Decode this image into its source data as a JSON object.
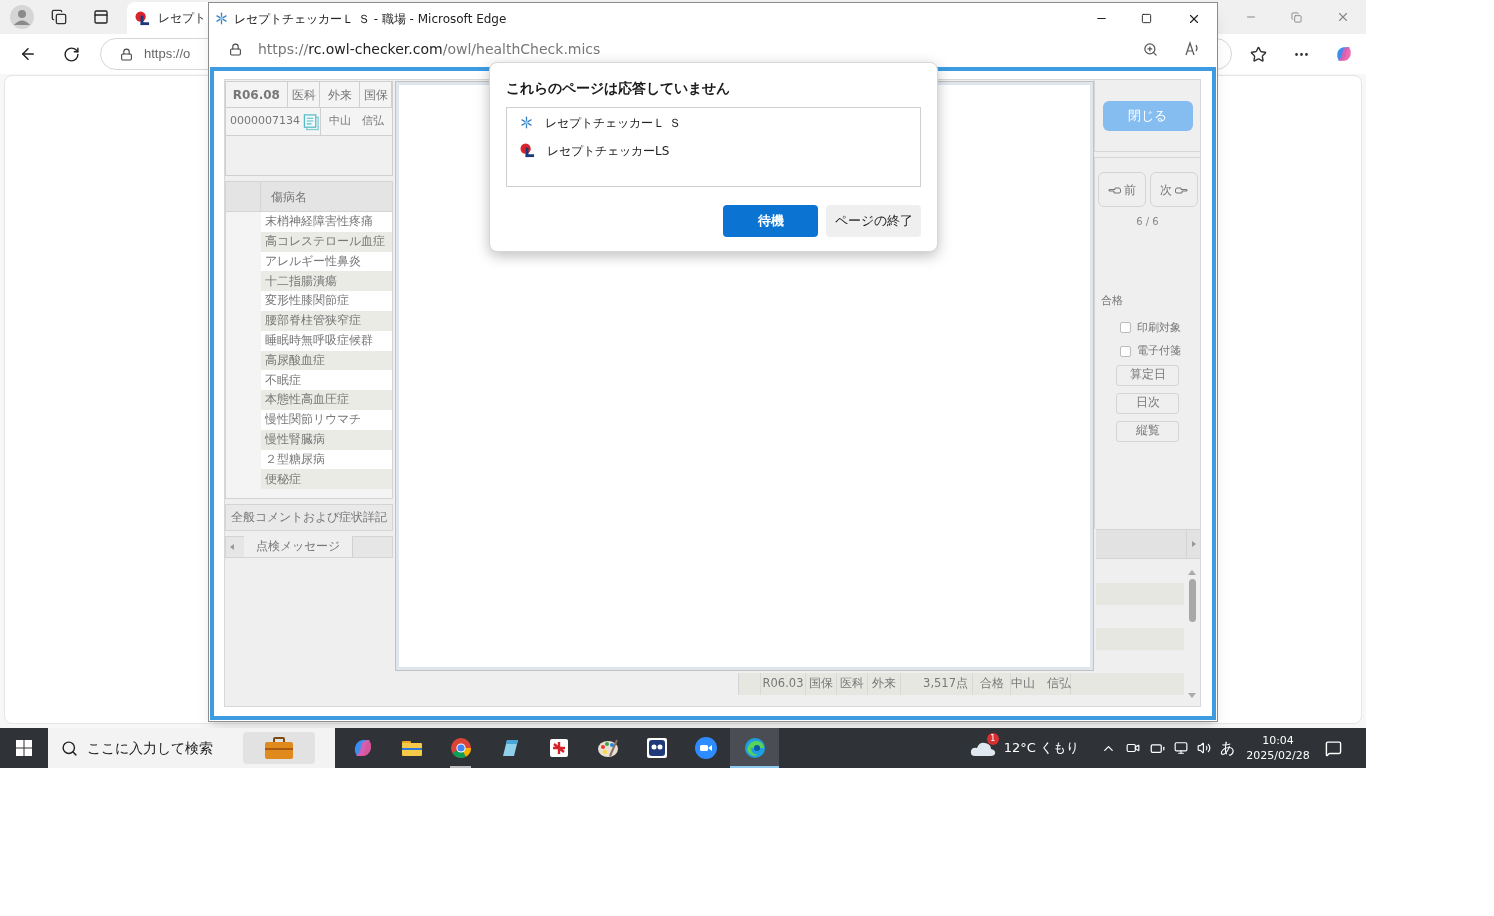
{
  "browser": {
    "tab_title": "レセプト",
    "address": "https://o"
  },
  "popup_window": {
    "title": "レセプトチェッカーＬ Ｓ - 職場 - Microsoft Edge",
    "url_prefix": "https://",
    "url_host": "rc.owl-checker.com",
    "url_path": "/owl/healthCheck.mics"
  },
  "app": {
    "header_cells": [
      "R06.08",
      "医科",
      "外来",
      "国保"
    ],
    "patient_id": "0000007134",
    "patient_name": "中山　信弘",
    "diagnosis_heading": "傷病名",
    "diagnoses": [
      "末梢神経障害性疼痛",
      "高コレステロール血症",
      "アレルギー性鼻炎",
      "十二指腸潰瘍",
      "変形性膝関節症",
      "腰部脊柱管狭窄症",
      "睡眠時無呼吸症候群",
      "高尿酸血症",
      "不眠症",
      "本態性高血圧症",
      "慢性関節リウマチ",
      "慢性腎臓病",
      "２型糖尿病",
      "便秘症"
    ],
    "comment_bar": "全般コメントおよび症状詳記",
    "tabs": [
      {
        "label": "点検メッセージ",
        "selected": true
      }
    ],
    "close_button": "閉じる",
    "prev_button": "前",
    "next_button": "次",
    "page_counter": "6 / 6",
    "result": "合格",
    "checkboxes": [
      {
        "label": "印刷対象",
        "checked": false
      },
      {
        "label": "電子付箋",
        "checked": false
      }
    ],
    "side_buttons": [
      "算定日",
      "日次",
      "縦覧"
    ],
    "history_rows": [
      {
        "cells": [
          "R06.03",
          "国保",
          "医科",
          "外来",
          "3,517点",
          "合格",
          "中山　信弘"
        ]
      }
    ]
  },
  "dialog": {
    "title": "これらのページは応答していません",
    "pages": [
      {
        "kind": "snowflake",
        "name": "レセプトチェッカーＬ Ｓ"
      },
      {
        "kind": "logo",
        "name": "レセプトチェッカーLS"
      }
    ],
    "buttons": [
      {
        "label": "待機",
        "primary": true
      },
      {
        "label": "ページの終了",
        "primary": false
      }
    ]
  },
  "taskbar": {
    "search_placeholder": "ここに入力して検索",
    "weather": "12°C くもり",
    "weather_badge": "1",
    "ime": "あ",
    "time": "10:04",
    "date": "2025/02/28",
    "apps": [
      {
        "kind": "copilot",
        "running": false,
        "selected": false
      },
      {
        "kind": "explorer",
        "running": false,
        "selected": false
      },
      {
        "kind": "chrome",
        "running": true,
        "selected": false
      },
      {
        "kind": "notes",
        "running": false,
        "selected": false
      },
      {
        "kind": "red-app",
        "running": false,
        "selected": false
      },
      {
        "kind": "palette",
        "running": false,
        "selected": false
      },
      {
        "kind": "owl-app",
        "running": false,
        "selected": false
      },
      {
        "kind": "zoom",
        "running": false,
        "selected": false
      },
      {
        "kind": "edge",
        "running": true,
        "selected": true
      }
    ]
  }
}
